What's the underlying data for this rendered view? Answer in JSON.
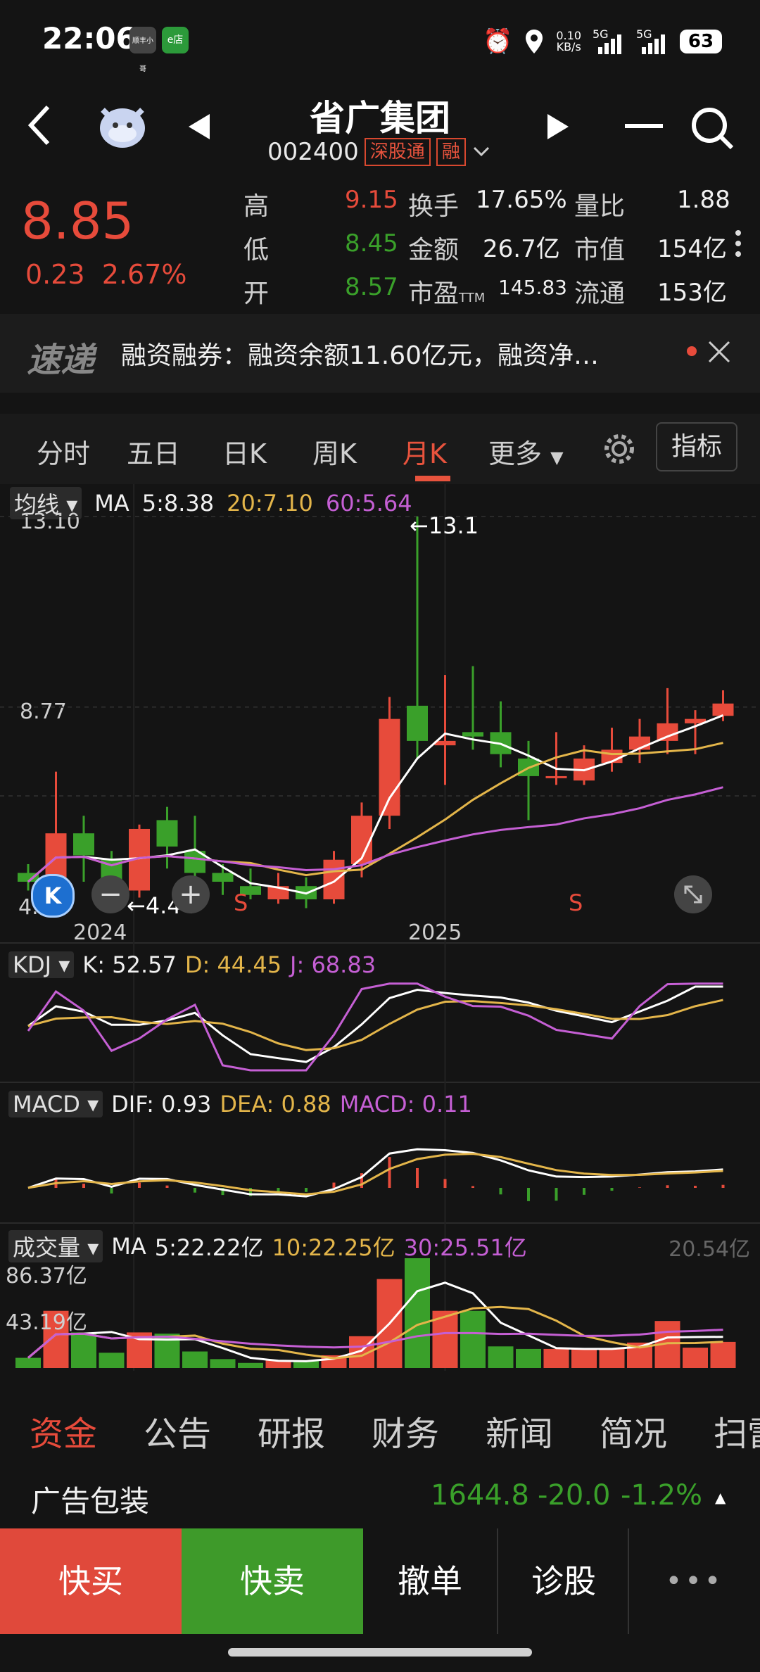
{
  "status_bar": {
    "time": "22:06",
    "app_badge_1": "顺丰小哥",
    "app_badge_2": "e店",
    "net_speed_value": "0.10",
    "net_speed_unit": "KB/s",
    "signal_1": "5G",
    "signal_2": "5G",
    "battery": "63"
  },
  "header": {
    "stock_name": "省广集团",
    "stock_code": "002400",
    "tag_connect": "深股通",
    "tag_margin": "融"
  },
  "quote": {
    "price": "8.85",
    "change": "0.23",
    "change_pct": "2.67%",
    "high_label": "高",
    "high": "9.15",
    "low_label": "低",
    "low": "8.45",
    "open_label": "开",
    "open": "8.57",
    "turnover_label": "换手",
    "turnover": "17.65%",
    "amount_label": "金额",
    "amount": "26.7亿",
    "pe_label": "市盈",
    "pe_sub": "TTM",
    "pe": "145.83",
    "vol_ratio_label": "量比",
    "vol_ratio": "1.88",
    "mkt_cap_label": "市值",
    "mkt_cap": "154亿",
    "float_label": "流通",
    "float_cap": "153亿"
  },
  "news": {
    "logo": "速递",
    "text": "融资融券：融资余额11.60亿元，融资净…"
  },
  "chart_tabs": {
    "items": [
      "分时",
      "五日",
      "日K",
      "周K",
      "月K",
      "更多"
    ],
    "active": "月K",
    "indicator": "指标"
  },
  "main_chart": {
    "selector": "均线",
    "ma_label": "MA",
    "ma5": "5:8.38",
    "ma20": "20:7.10",
    "ma60": "60:5.64",
    "y_top": "13.10",
    "y_mid": "8.77",
    "y_bottom": "4.24",
    "max_mark": "13.1",
    "min_mark": "4.44",
    "signal_s1": "S",
    "signal_s2": "S",
    "x_labels": [
      "2024",
      "2025"
    ]
  },
  "kdj": {
    "selector": "KDJ",
    "k": "K: 52.57",
    "d": "D: 44.45",
    "j": "J: 68.83"
  },
  "macd": {
    "selector": "MACD",
    "dif": "DIF: 0.93",
    "dea": "DEA: 0.88",
    "macd": "MACD: 0.11"
  },
  "volume": {
    "selector": "成交量",
    "ma_label": "MA",
    "ma5": "5:22.22亿",
    "ma10": "10:22.25亿",
    "ma30": "30:25.51亿",
    "right_value": "20.54亿",
    "y_top": "86.37亿",
    "y_mid": "43.19亿"
  },
  "bottom_tabs": {
    "items": [
      "资金",
      "公告",
      "研报",
      "财务",
      "新闻",
      "简况",
      "扫雷"
    ],
    "active": "资金"
  },
  "sector": {
    "name": "广告包装",
    "value": "1644.8",
    "change": "-20.0",
    "change_pct": "-1.2%"
  },
  "actions": {
    "buy": "快买",
    "sell": "快卖",
    "cancel": "撤单",
    "diagnose": "诊股",
    "more": "•••"
  },
  "colors": {
    "up": "#e74b3b",
    "down": "#3aa02a",
    "ma5": "#ffffff",
    "ma20": "#e3b54a",
    "ma60": "#c55fd4"
  },
  "chart_data": {
    "type": "candlestick",
    "period": "monthly",
    "x_labels": [
      "2024",
      "2025"
    ],
    "y_ticks": [
      13.1,
      8.77,
      4.24
    ],
    "candles": [
      {
        "o": 5.0,
        "c": 4.8,
        "h": 5.2,
        "l": 4.6
      },
      {
        "o": 4.7,
        "c": 5.9,
        "h": 7.3,
        "l": 4.4
      },
      {
        "o": 5.9,
        "c": 5.4,
        "h": 6.3,
        "l": 4.8
      },
      {
        "o": 5.3,
        "c": 4.6,
        "h": 5.5,
        "l": 4.4
      },
      {
        "o": 4.6,
        "c": 6.0,
        "h": 6.1,
        "l": 4.44
      },
      {
        "o": 6.2,
        "c": 5.6,
        "h": 6.5,
        "l": 5.1
      },
      {
        "o": 5.5,
        "c": 5.0,
        "h": 6.3,
        "l": 4.8
      },
      {
        "o": 5.0,
        "c": 4.8,
        "h": 5.2,
        "l": 4.5
      },
      {
        "o": 4.7,
        "c": 4.5,
        "h": 5.1,
        "l": 4.4
      },
      {
        "o": 4.4,
        "c": 4.7,
        "h": 5.0,
        "l": 4.3
      },
      {
        "o": 4.7,
        "c": 4.4,
        "h": 4.9,
        "l": 4.2
      },
      {
        "o": 4.4,
        "c": 5.3,
        "h": 5.5,
        "l": 4.3
      },
      {
        "o": 5.2,
        "c": 6.3,
        "h": 6.6,
        "l": 4.9
      },
      {
        "o": 6.3,
        "c": 8.5,
        "h": 9.0,
        "l": 6.0
      },
      {
        "o": 8.8,
        "c": 8.0,
        "h": 13.1,
        "l": 7.6
      },
      {
        "o": 7.9,
        "c": 8.0,
        "h": 9.5,
        "l": 7.0
      },
      {
        "o": 8.2,
        "c": 8.1,
        "h": 9.7,
        "l": 7.8
      },
      {
        "o": 8.2,
        "c": 7.7,
        "h": 8.9,
        "l": 7.4
      },
      {
        "o": 7.6,
        "c": 7.2,
        "h": 8.0,
        "l": 6.2
      },
      {
        "o": 7.2,
        "c": 7.2,
        "h": 8.2,
        "l": 7.0
      },
      {
        "o": 7.1,
        "c": 7.6,
        "h": 7.9,
        "l": 7.0
      },
      {
        "o": 7.5,
        "c": 7.8,
        "h": 8.3,
        "l": 7.3
      },
      {
        "o": 7.8,
        "c": 8.1,
        "h": 8.5,
        "l": 7.5
      },
      {
        "o": 8.0,
        "c": 8.4,
        "h": 9.2,
        "l": 7.7
      },
      {
        "o": 8.4,
        "c": 8.5,
        "h": 8.7,
        "l": 7.7
      },
      {
        "o": 8.57,
        "c": 8.85,
        "h": 9.15,
        "l": 8.45
      }
    ],
    "volume": [
      8,
      45,
      28,
      12,
      28,
      27,
      13,
      7,
      4,
      6,
      6,
      10,
      25,
      70,
      86.37,
      45,
      45,
      17,
      15,
      15,
      15,
      15,
      20,
      37,
      16,
      20.54
    ]
  }
}
